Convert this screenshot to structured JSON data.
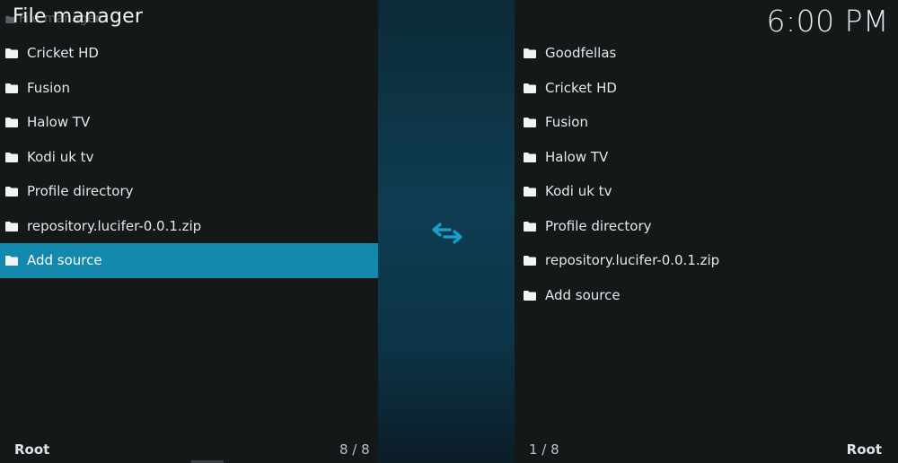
{
  "header": {
    "title": "File manager",
    "faded_crumb": "File manager",
    "clock": "6:00 PM"
  },
  "left_pane": {
    "items": [
      {
        "label": "Cricket HD"
      },
      {
        "label": "Fusion"
      },
      {
        "label": "Halow TV"
      },
      {
        "label": "Kodi uk tv"
      },
      {
        "label": "Profile directory"
      },
      {
        "label": "repository.lucifer-0.0.1.zip"
      },
      {
        "label": "Add source",
        "selected": true
      }
    ],
    "footer_path": "Root",
    "footer_count": "8 / 8"
  },
  "right_pane": {
    "items": [
      {
        "label": "Goodfellas"
      },
      {
        "label": "Cricket HD"
      },
      {
        "label": "Fusion"
      },
      {
        "label": "Halow TV"
      },
      {
        "label": "Kodi uk tv"
      },
      {
        "label": "Profile directory"
      },
      {
        "label": "repository.lucifer-0.0.1.zip"
      },
      {
        "label": "Add source"
      }
    ],
    "footer_path": "Root",
    "footer_count": "1 / 8"
  },
  "center": {
    "swap_icon": "swap-arrows-icon",
    "accent_color": "#1289ad"
  }
}
